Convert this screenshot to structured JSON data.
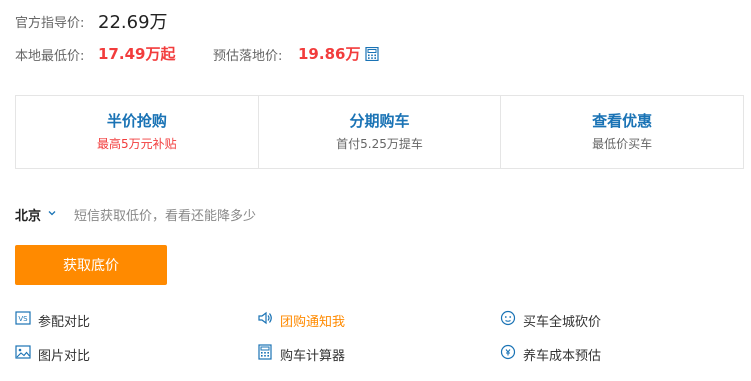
{
  "price": {
    "guide_label": "官方指导价:",
    "guide_value": "22.69万",
    "local_label": "本地最低价:",
    "local_value": "17.49万起",
    "est_label": "预估落地价:",
    "est_value": "19.86万",
    "calc_icon": "calculator-icon"
  },
  "cards": [
    {
      "title": "半价抢购",
      "sub": "最高5万元补贴",
      "sub_color": "#f23c3c"
    },
    {
      "title": "分期购车",
      "sub": "首付5.25万提车",
      "sub_color": "#666666"
    },
    {
      "title": "查看优惠",
      "sub": "最低价买车",
      "sub_color": "#666666"
    }
  ],
  "location": {
    "city": "北京",
    "hint": "短信获取低价，看看还能降多少"
  },
  "cta": {
    "label": "获取底价"
  },
  "links": [
    {
      "label": "参配对比",
      "icon": "vs-icon"
    },
    {
      "label": "团购通知我",
      "icon": "speaker-icon"
    },
    {
      "label": "买车全城砍价",
      "icon": "bargain-face-icon"
    },
    {
      "label": "图片对比",
      "icon": "image-icon"
    },
    {
      "label": "购车计算器",
      "icon": "calculator-icon"
    },
    {
      "label": "养车成本预估",
      "icon": "cost-icon"
    }
  ],
  "colors": {
    "accent_blue": "#1a73b5",
    "price_red": "#f23c3c",
    "cta_orange": "#ff8a00"
  }
}
